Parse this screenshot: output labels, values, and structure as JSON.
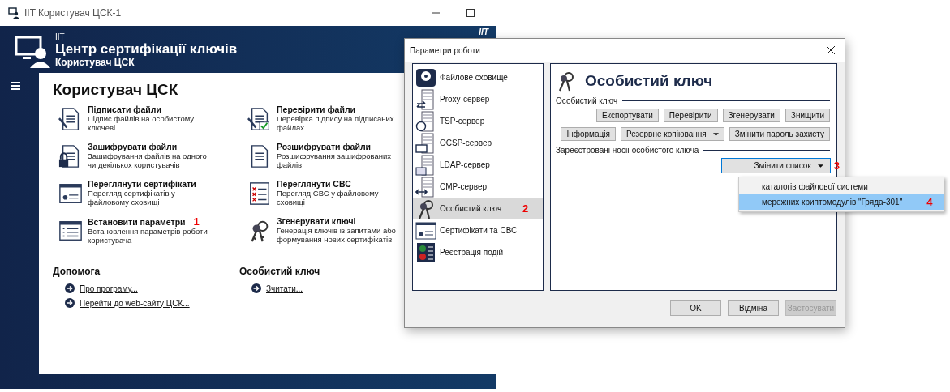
{
  "main_window": {
    "title": "IIT Користувач ЦСК-1",
    "header": {
      "brand": "IIT",
      "title": "Центр сертифікації ключів",
      "subtitle": "Користувач ЦСК",
      "corner": "IIT"
    },
    "heading": "Користувач ЦСК",
    "actions": [
      {
        "kind": "sign",
        "title": "Підписати файли",
        "description": "Підпис файлів на особистому ключеві"
      },
      {
        "kind": "verify",
        "title": "Перевірити файли",
        "description": "Перевірка підпису на підписаних файлах"
      },
      {
        "kind": "encrypt",
        "title": "Зашифрувати файли",
        "description": "Зашифрування файлів на одного чи декількох користувачів"
      },
      {
        "kind": "decrypt",
        "title": "Розшифрувати файли",
        "description": "Розшифрування зашифрованих файлів"
      },
      {
        "kind": "certs",
        "title": "Переглянути сертифікати",
        "description": "Перегляд сертифікатів у файловому сховищі"
      },
      {
        "kind": "crl",
        "title": "Переглянути СВС",
        "description": "Перегляд СВС у файловому сховищі"
      },
      {
        "kind": "settings",
        "title": "Встановити параметри",
        "description": "Встановлення параметрів роботи користувача",
        "marker": "1"
      },
      {
        "kind": "keys",
        "title": "Згенерувати ключі",
        "description": "Генерація ключів із запитами або формування нових сертифікатів"
      }
    ],
    "sections": [
      {
        "title": "Допомога",
        "links": [
          "Про програму...",
          "Перейти до web-сайту ЦСК..."
        ]
      },
      {
        "title": "Особистий ключ",
        "links": [
          "Зчитати..."
        ]
      }
    ]
  },
  "dialog": {
    "title": "Параметри роботи",
    "nav": [
      {
        "kind": "disk",
        "label": "Файлове сховище",
        "selected": false
      },
      {
        "kind": "proxy",
        "label": "Proxy-сервер",
        "selected": false
      },
      {
        "kind": "tsp",
        "label": "TSP-сервер",
        "selected": false
      },
      {
        "kind": "ocsp",
        "label": "OCSP-сервер",
        "selected": false
      },
      {
        "kind": "ldap",
        "label": "LDAP-сервер",
        "selected": false
      },
      {
        "kind": "cmp",
        "label": "CMP-сервер",
        "selected": false
      },
      {
        "kind": "key",
        "label": "Особистий ключ",
        "selected": true,
        "marker": "2"
      },
      {
        "kind": "certs",
        "label": "Сертифікати та СВС",
        "selected": false
      },
      {
        "kind": "log",
        "label": "Реєстрація подій",
        "selected": false
      }
    ],
    "panel_title": "Особистий ключ",
    "group_key": {
      "label": "Особистий ключ",
      "rows": [
        [
          {
            "kind": "button",
            "label": "Експортувати"
          },
          {
            "kind": "button",
            "label": "Перевірити"
          },
          {
            "kind": "button",
            "label": "Згенерувати"
          },
          {
            "kind": "button",
            "label": "Знищити"
          }
        ],
        [
          {
            "kind": "button",
            "label": "Інформація"
          },
          {
            "kind": "dropdown",
            "label": "Резервне копіювання"
          },
          {
            "kind": "button",
            "label": "Змінити пароль захисту"
          }
        ]
      ]
    },
    "group_media": {
      "label": "Зареєстровані носії особистого ключа",
      "dropdown": {
        "label": "Змінити список",
        "marker": "3"
      }
    },
    "menu": [
      {
        "label": "каталогів файлової системи",
        "selected": false
      },
      {
        "label": "мережних криптомодулів \"Гряда-301\"",
        "selected": true,
        "marker": "4"
      }
    ],
    "footer": [
      {
        "label": "OK",
        "disabled": false
      },
      {
        "label": "Відміна",
        "disabled": false
      },
      {
        "label": "Застосувати",
        "disabled": true
      }
    ]
  }
}
